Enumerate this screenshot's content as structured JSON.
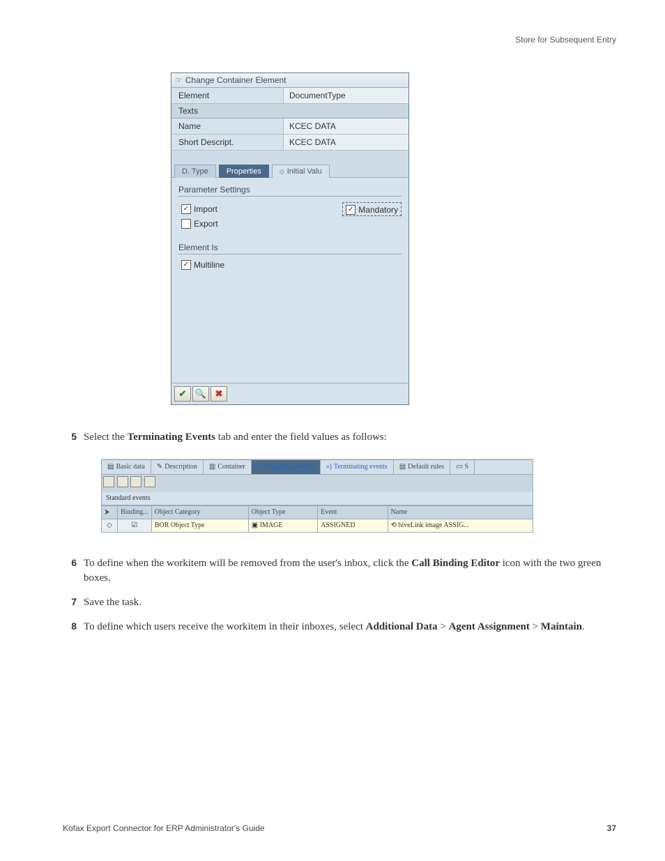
{
  "header": {
    "section_title": "Store for Subsequent Entry"
  },
  "dialog": {
    "title": "Change Container Element",
    "element_label": "Element",
    "element_value": "DocumentType",
    "texts_label": "Texts",
    "name_label": "Name",
    "name_value": "KCEC DATA",
    "shortdesc_label": "Short Descript.",
    "shortdesc_value": "KCEC DATA",
    "tabs": {
      "dtype": "D. Type",
      "properties": "Properties",
      "initial": "Initial Valu"
    },
    "param_group": "Parameter Settings",
    "import_label": "Import",
    "export_label": "Export",
    "mandatory_label": "Mandatory",
    "elementis_group": "Element Is",
    "multiline_label": "Multiline"
  },
  "steps": {
    "s5": {
      "num": "5",
      "pre": "Select the ",
      "bold1": "Terminating Events",
      "post": " tab and enter the field values as follows:"
    },
    "s6": {
      "num": "6",
      "pre": "To define when the workitem will be removed from the user's inbox, click the ",
      "bold1": "Call Binding Editor",
      "post": " icon with the two green boxes."
    },
    "s7": {
      "num": "7",
      "text": "Save the task."
    },
    "s8": {
      "num": "8",
      "pre": "To define which users receive the workitem in their inboxes, select ",
      "bold1": "Additional Data",
      "sep1": " > ",
      "bold2": "Agent Assignment",
      "sep2": " > ",
      "bold3": "Maintain",
      "post": "."
    }
  },
  "wide": {
    "tabs": {
      "basic": "Basic data",
      "desc": "Description",
      "container": "Container",
      "trigger": "Triggering events",
      "term": "Terminating events",
      "default": "Default rules",
      "last": "S"
    },
    "std_events": "Standard events",
    "cols": {
      "binding": "Binding...",
      "objcat": "Object Category",
      "objtype": "Object Type",
      "event": "Event",
      "name": "Name"
    },
    "row": {
      "objcat": "BOR Object Type",
      "objtype": "IMAGE",
      "event": "ASSIGNED",
      "name": "hiveLink image ASSIG..."
    },
    "glyphs": {
      "diamond": "◇",
      "check": "☑",
      "doc": "▣",
      "link": "⟲"
    }
  },
  "footer": {
    "left": "Kofax Export Connector for ERP Administrator's Guide",
    "page": "37"
  }
}
